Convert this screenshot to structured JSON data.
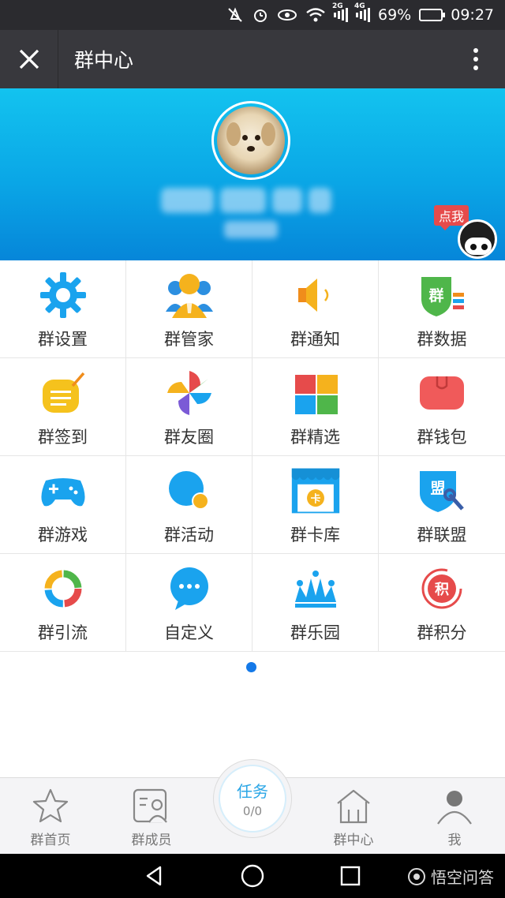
{
  "status_bar": {
    "battery": "69%",
    "time": "09:27",
    "net1": "2G",
    "net2": "4G"
  },
  "header": {
    "title": "群中心"
  },
  "banner": {
    "badge": "点我"
  },
  "grid": [
    {
      "label": "群设置",
      "icon": "gear-icon"
    },
    {
      "label": "群管家",
      "icon": "butler-icon"
    },
    {
      "label": "群通知",
      "icon": "speaker-icon"
    },
    {
      "label": "群数据",
      "icon": "data-icon"
    },
    {
      "label": "群签到",
      "icon": "checkin-icon"
    },
    {
      "label": "群友圈",
      "icon": "pinwheel-icon"
    },
    {
      "label": "群精选",
      "icon": "tiles-icon"
    },
    {
      "label": "群钱包",
      "icon": "wallet-icon"
    },
    {
      "label": "群游戏",
      "icon": "gamepad-icon"
    },
    {
      "label": "群活动",
      "icon": "activity-icon"
    },
    {
      "label": "群卡库",
      "icon": "card-store-icon"
    },
    {
      "label": "群联盟",
      "icon": "alliance-icon"
    },
    {
      "label": "群引流",
      "icon": "ring-icon"
    },
    {
      "label": "自定义",
      "icon": "chat-bubble-icon"
    },
    {
      "label": "群乐园",
      "icon": "crown-icon"
    },
    {
      "label": "群积分",
      "icon": "points-icon"
    }
  ],
  "grid_text": {
    "card": "卡",
    "alliance": "盟",
    "data": "群",
    "points": "积"
  },
  "tabbar": {
    "home": "群首页",
    "members": "群成员",
    "task_title": "任务",
    "task_progress": "0/0",
    "center": "群中心",
    "me": "我"
  },
  "watermark": "悟空问答",
  "colors": {
    "accent": "#1aa3ee",
    "banner_top": "#13c3ef",
    "banner_bottom": "#0686d9"
  }
}
